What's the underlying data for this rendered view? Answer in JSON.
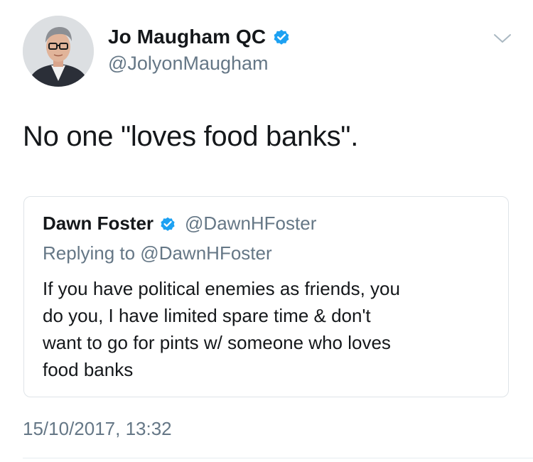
{
  "author": {
    "display_name": "Jo Maugham QC",
    "handle": "@JolyonMaugham",
    "verified": true
  },
  "tweet": {
    "text": "No one \"loves food banks\".",
    "timestamp": "15/10/2017, 13:32"
  },
  "quoted_tweet": {
    "display_name": "Dawn Foster",
    "handle": "@DawnHFoster",
    "verified": true,
    "replying_to": "Replying to @DawnHFoster",
    "text_lines": [
      "If you have political enemies as friends, you",
      "do you, I have limited spare time & don't",
      "want to go for pints w/ someone who loves",
      "food banks"
    ]
  },
  "icons": {
    "verified": "verified-badge-icon",
    "menu": "chevron-down-icon"
  },
  "colors": {
    "verified_blue": "#1da1f2",
    "secondary_text": "#657786",
    "primary_text": "#14171a",
    "border": "#dfe4e8"
  }
}
